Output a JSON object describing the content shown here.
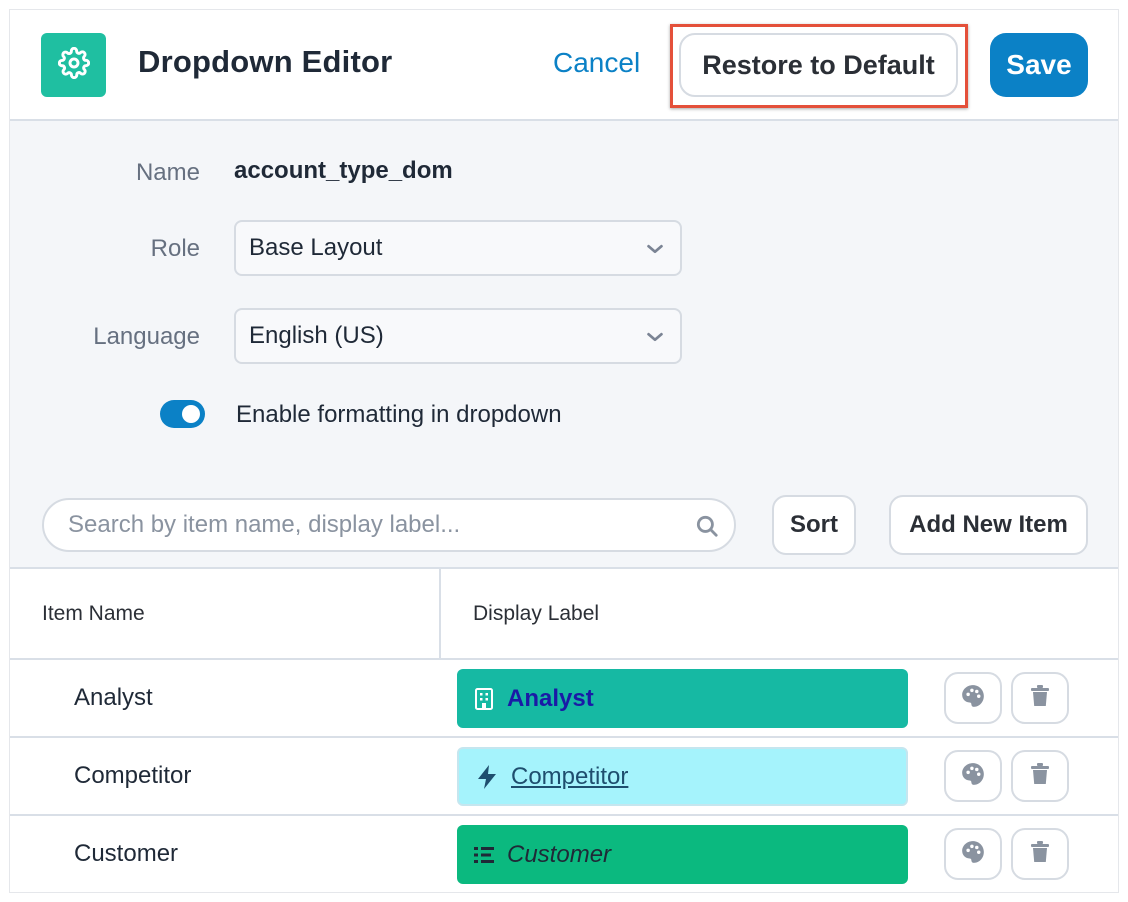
{
  "header": {
    "title": "Dropdown Editor",
    "cancel_label": "Cancel",
    "restore_label": "Restore to Default",
    "save_label": "Save",
    "app_icon": "gear-icon"
  },
  "form": {
    "name_label": "Name",
    "name_value": "account_type_dom",
    "role_label": "Role",
    "role_value": "Base Layout",
    "language_label": "Language",
    "language_value": "English (US)",
    "formatting_toggle_label": "Enable formatting in dropdown",
    "formatting_enabled": true
  },
  "toolbar": {
    "search_placeholder": "Search by item name, display label...",
    "sort_label": "Sort",
    "add_label": "Add New Item"
  },
  "table": {
    "columns": [
      "Item Name",
      "Display Label"
    ],
    "rows": [
      {
        "name": "Analyst",
        "label": "Analyst",
        "icon": "building-icon",
        "bg": "#16b9a3",
        "text_color": "#1a1aa6",
        "bold": true,
        "underline": false,
        "italic": false
      },
      {
        "name": "Competitor",
        "label": "Competitor",
        "icon": "lightning-icon",
        "bg": "#a5f3fc",
        "text_color": "#1e4e6e",
        "bold": false,
        "underline": true,
        "italic": false
      },
      {
        "name": "Customer",
        "label": "Customer",
        "icon": "list-icon",
        "bg": "#0bb97f",
        "text_color": "#1f2937",
        "bold": false,
        "underline": false,
        "italic": true
      }
    ]
  },
  "colors": {
    "accent": "#0b81c6",
    "brand_icon_bg": "#1fbfa1",
    "highlight_border": "#e4503a"
  }
}
